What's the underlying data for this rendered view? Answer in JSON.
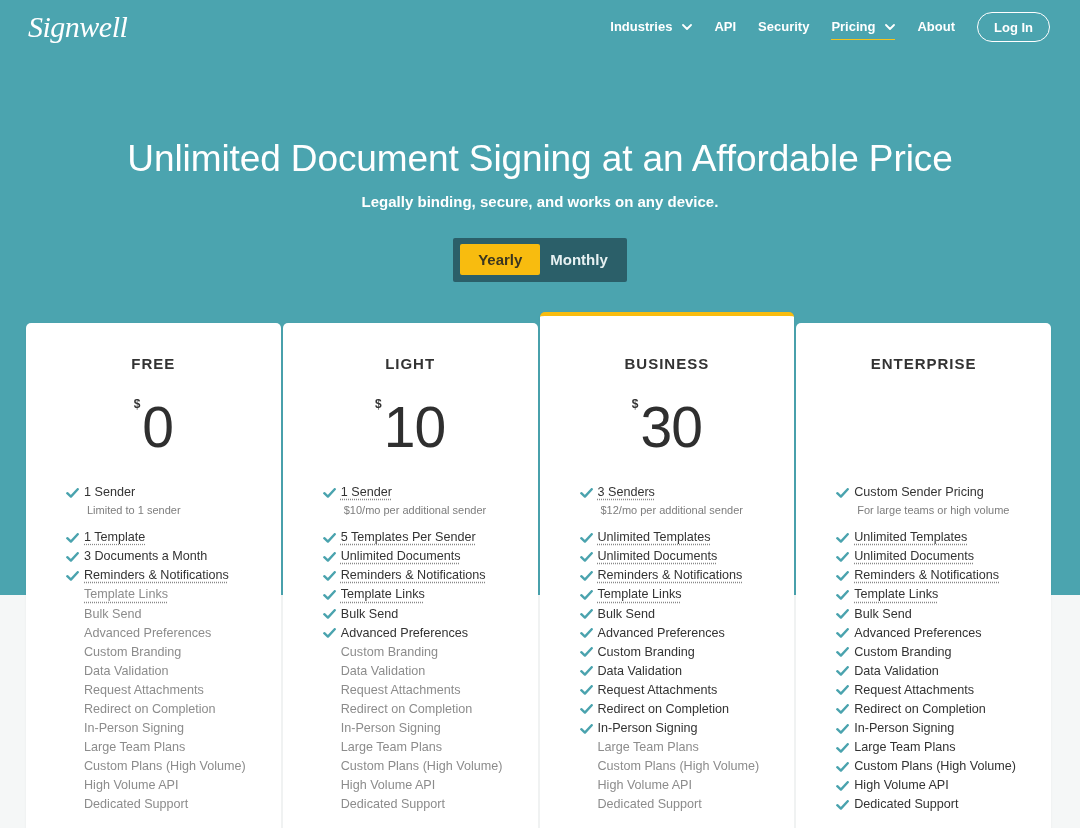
{
  "header": {
    "logo": "Signwell",
    "nav": [
      {
        "label": "Industries",
        "has_menu": true,
        "selected": false
      },
      {
        "label": "API",
        "has_menu": false,
        "selected": false
      },
      {
        "label": "Security",
        "has_menu": false,
        "selected": false
      },
      {
        "label": "Pricing",
        "has_menu": true,
        "selected": true
      },
      {
        "label": "About",
        "has_menu": false,
        "selected": false
      }
    ],
    "login_button": "Log In"
  },
  "hero": {
    "title": "Unlimited Document Signing at an Affordable Price",
    "subtitle": "Legally binding, secure, and works on any device.",
    "billing_toggle": [
      {
        "label": "Yearly",
        "selected": true
      },
      {
        "label": "Monthly",
        "selected": false
      }
    ]
  },
  "plans": [
    {
      "name": "FREE",
      "highlighted": false,
      "currency": "$",
      "price": "0",
      "seats": {
        "label": "1 Sender",
        "note": "Limited to 1 sender",
        "included": true,
        "has_tooltip": false
      },
      "features": [
        {
          "label": "1 Template",
          "included": true,
          "has_tooltip": true
        },
        {
          "label": "3 Documents a Month",
          "included": true,
          "has_tooltip": false
        },
        {
          "label": "Reminders & Notifications",
          "included": true,
          "has_tooltip": true
        },
        {
          "label": "Template Links",
          "included": false,
          "has_tooltip": true
        },
        {
          "label": "Bulk Send",
          "included": false,
          "has_tooltip": false
        },
        {
          "label": "Advanced Preferences",
          "included": false,
          "has_tooltip": false
        },
        {
          "label": "Custom Branding",
          "included": false,
          "has_tooltip": false
        },
        {
          "label": "Data Validation",
          "included": false,
          "has_tooltip": false
        },
        {
          "label": "Request Attachments",
          "included": false,
          "has_tooltip": false
        },
        {
          "label": "Redirect on Completion",
          "included": false,
          "has_tooltip": false
        },
        {
          "label": "In-Person Signing",
          "included": false,
          "has_tooltip": false
        },
        {
          "label": "Large Team Plans",
          "included": false,
          "has_tooltip": false
        },
        {
          "label": "Custom Plans (High Volume)",
          "included": false,
          "has_tooltip": false
        },
        {
          "label": "High Volume API",
          "included": false,
          "has_tooltip": false
        },
        {
          "label": "Dedicated Support",
          "included": false,
          "has_tooltip": false
        }
      ]
    },
    {
      "name": "LIGHT",
      "highlighted": false,
      "currency": "$",
      "price": "10",
      "seats": {
        "label": "1 Sender",
        "note": "$10/mo per additional sender",
        "included": true,
        "has_tooltip": true
      },
      "features": [
        {
          "label": "5 Templates Per Sender",
          "included": true,
          "has_tooltip": true
        },
        {
          "label": "Unlimited Documents",
          "included": true,
          "has_tooltip": true
        },
        {
          "label": "Reminders & Notifications",
          "included": true,
          "has_tooltip": true
        },
        {
          "label": "Template Links",
          "included": true,
          "has_tooltip": true
        },
        {
          "label": "Bulk Send",
          "included": true,
          "has_tooltip": false
        },
        {
          "label": "Advanced Preferences",
          "included": true,
          "has_tooltip": false
        },
        {
          "label": "Custom Branding",
          "included": false,
          "has_tooltip": false
        },
        {
          "label": "Data Validation",
          "included": false,
          "has_tooltip": false
        },
        {
          "label": "Request Attachments",
          "included": false,
          "has_tooltip": false
        },
        {
          "label": "Redirect on Completion",
          "included": false,
          "has_tooltip": false
        },
        {
          "label": "In-Person Signing",
          "included": false,
          "has_tooltip": false
        },
        {
          "label": "Large Team Plans",
          "included": false,
          "has_tooltip": false
        },
        {
          "label": "Custom Plans (High Volume)",
          "included": false,
          "has_tooltip": false
        },
        {
          "label": "High Volume API",
          "included": false,
          "has_tooltip": false
        },
        {
          "label": "Dedicated Support",
          "included": false,
          "has_tooltip": false
        }
      ]
    },
    {
      "name": "BUSINESS",
      "highlighted": true,
      "currency": "$",
      "price": "30",
      "seats": {
        "label": "3 Senders",
        "note": "$12/mo per additional sender",
        "included": true,
        "has_tooltip": true
      },
      "features": [
        {
          "label": "Unlimited Templates",
          "included": true,
          "has_tooltip": true
        },
        {
          "label": "Unlimited Documents",
          "included": true,
          "has_tooltip": true
        },
        {
          "label": "Reminders & Notifications",
          "included": true,
          "has_tooltip": true
        },
        {
          "label": "Template Links",
          "included": true,
          "has_tooltip": true
        },
        {
          "label": "Bulk Send",
          "included": true,
          "has_tooltip": false
        },
        {
          "label": "Advanced Preferences",
          "included": true,
          "has_tooltip": false
        },
        {
          "label": "Custom Branding",
          "included": true,
          "has_tooltip": false
        },
        {
          "label": "Data Validation",
          "included": true,
          "has_tooltip": false
        },
        {
          "label": "Request Attachments",
          "included": true,
          "has_tooltip": false
        },
        {
          "label": "Redirect on Completion",
          "included": true,
          "has_tooltip": false
        },
        {
          "label": "In-Person Signing",
          "included": true,
          "has_tooltip": false
        },
        {
          "label": "Large Team Plans",
          "included": false,
          "has_tooltip": false
        },
        {
          "label": "Custom Plans (High Volume)",
          "included": false,
          "has_tooltip": false
        },
        {
          "label": "High Volume API",
          "included": false,
          "has_tooltip": false
        },
        {
          "label": "Dedicated Support",
          "included": false,
          "has_tooltip": false
        }
      ]
    },
    {
      "name": "ENTERPRISE",
      "highlighted": false,
      "seats": {
        "label": "Custom Sender Pricing",
        "note": "For large teams or high volume",
        "included": true,
        "has_tooltip": false
      },
      "features": [
        {
          "label": "Unlimited Templates",
          "included": true,
          "has_tooltip": true
        },
        {
          "label": "Unlimited Documents",
          "included": true,
          "has_tooltip": true
        },
        {
          "label": "Reminders & Notifications",
          "included": true,
          "has_tooltip": true
        },
        {
          "label": "Template Links",
          "included": true,
          "has_tooltip": true
        },
        {
          "label": "Bulk Send",
          "included": true,
          "has_tooltip": false
        },
        {
          "label": "Advanced Preferences",
          "included": true,
          "has_tooltip": false
        },
        {
          "label": "Custom Branding",
          "included": true,
          "has_tooltip": false
        },
        {
          "label": "Data Validation",
          "included": true,
          "has_tooltip": false
        },
        {
          "label": "Request Attachments",
          "included": true,
          "has_tooltip": false
        },
        {
          "label": "Redirect on Completion",
          "included": true,
          "has_tooltip": false
        },
        {
          "label": "In-Person Signing",
          "included": true,
          "has_tooltip": false
        },
        {
          "label": "Large Team Plans",
          "included": true,
          "has_tooltip": false
        },
        {
          "label": "Custom Plans (High Volume)",
          "included": true,
          "has_tooltip": false
        },
        {
          "label": "High Volume API",
          "included": true,
          "has_tooltip": false
        },
        {
          "label": "Dedicated Support",
          "included": true,
          "has_tooltip": false
        }
      ]
    }
  ]
}
